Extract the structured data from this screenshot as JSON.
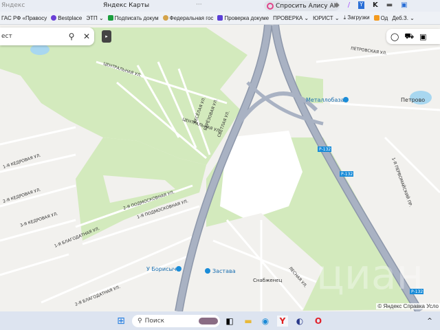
{
  "browser": {
    "host": "Яндекс",
    "title": "Яндекс Карты",
    "more": "···",
    "alice_label": "Спросить Алису AI",
    "bookmarks": [
      "ГАС РФ «Правосу",
      "Bestplace",
      "ЭТП ⌄",
      "Подписать докум",
      "Федеральная гос",
      "Проверка докуме",
      "ПРОВЕРКА ⌄",
      "ЮРИСТ ⌄",
      "⤓ Загрузки",
      "Од",
      "Деб.З. ⌄"
    ]
  },
  "search": {
    "query": "ест",
    "search_icon": "search-icon",
    "clear_icon": "close-icon",
    "panel_toggle": "▸"
  },
  "map": {
    "labels": {
      "metallobaza": "Металлобаза",
      "petrovo": "Петрово",
      "borisycha": "У Борисыча",
      "zastava": "Застава",
      "r132a": "Р-132",
      "r132b": "Р-132",
      "r132c": "Р-132",
      "petrovskaya": "ПЕТРОВСКАЯ УЛ.",
      "centralnaya": "ЦЕНТРАЛЬНАЯ УЛ.",
      "centralnaya2": "ЦЕНТРАЛЬНАЯ УЛ.",
      "vesyolaya": "ВЕСЁЛАЯ УЛ.",
      "svetlaya": "СВЕТЛАЯ УЛ.",
      "birch": "БЕРЁЗОВАЯ УЛ.",
      "kedrovaya1": "1-Я КЕДРОВАЯ УЛ.",
      "kedrovaya2": "2-Я КЕДРОВАЯ УЛ.",
      "kedrovaya3": "3-Я КЕДРОВАЯ УЛ.",
      "podmoskovnaya1": "1-Я ПОДМОСКОВНАЯ УЛ.",
      "podmoskovnaya2": "2-Я ПОДМОСКОВНАЯ УЛ.",
      "blagodatnaya1": "1-Я БЛАГОДАТНАЯ УЛ.",
      "blagodatnaya2": "2-Я БЛАГОДАТНАЯ УЛ.",
      "snabzhenets": "Снабженец",
      "lesnaya": "ЛЕСНАЯ УЛ.",
      "pervomayskaya": "1-Я ПЕРВОМАЙСКИЙ ПР.",
      "watermark": "циан"
    },
    "colors": {
      "land": "#f2f1ee",
      "forest": "#d3eabd",
      "road": "#a9b2c3",
      "road_edge": "#8d97aa",
      "water": "#a8d7f0",
      "poi": "#1a8cd8"
    }
  },
  "copyright": {
    "yandex": "© Яндекс",
    "help": "Справка",
    "terms": "Усло"
  },
  "taskbar": {
    "search_placeholder": "Поиск"
  }
}
